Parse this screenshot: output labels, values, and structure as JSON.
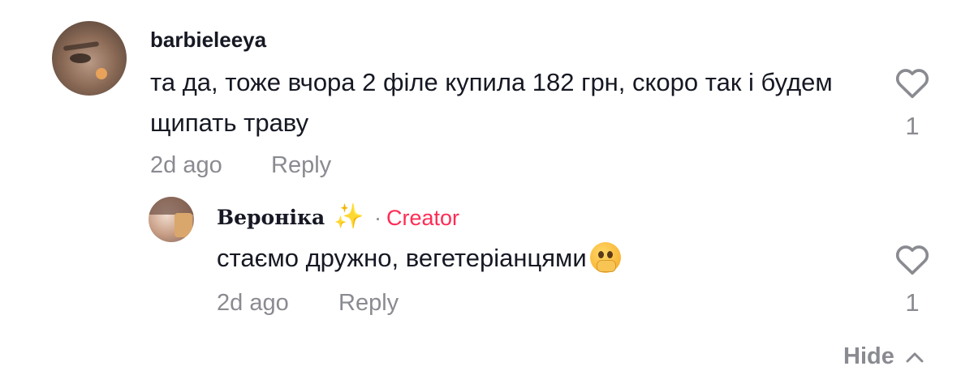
{
  "comment": {
    "username": "barbieleeya",
    "text": "та да, тоже вчора 2 філе купила 182 грн, скоро так і будем щипать траву",
    "time": "2d ago",
    "reply_label": "Reply",
    "likes": "1"
  },
  "reply": {
    "username": "Вероніка",
    "creator_sep": "·",
    "creator_label": "Creator",
    "text": "стаємо дружно, вегетеріанцями",
    "time": "2d ago",
    "reply_label": "Reply",
    "likes": "1"
  },
  "hide_label": "Hide",
  "icons": {
    "like": "heart-outline-icon",
    "hide": "chevron-up-icon",
    "sparkle": "sparkles-icon",
    "emoji": "face-with-hand-over-mouth-emoji"
  },
  "colors": {
    "text": "#161823",
    "muted": "#8a8b91",
    "creator": "#fe2c55"
  }
}
